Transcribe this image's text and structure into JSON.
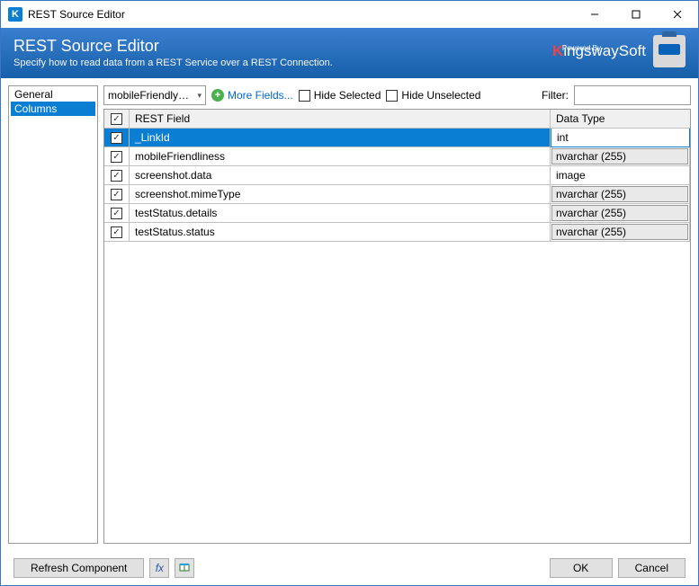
{
  "window": {
    "title": "REST Source Editor"
  },
  "banner": {
    "title": "REST Source Editor",
    "subtitle": "Specify how to read data from a REST Service over a REST Connection.",
    "poweredBy": "Powered By",
    "brand_prefix": "K",
    "brand_rest": "ingswaySoft"
  },
  "sidebar": {
    "items": [
      {
        "label": "General",
        "selected": false
      },
      {
        "label": "Columns",
        "selected": true
      }
    ]
  },
  "toolbar": {
    "dropdown_value": "mobileFriendlyTes",
    "more_fields": "More Fields...",
    "hide_selected": "Hide Selected",
    "hide_unselected": "Hide Unselected",
    "filter_label": "Filter:",
    "filter_value": ""
  },
  "grid": {
    "col_rest": "REST Field",
    "col_type": "Data Type",
    "rows": [
      {
        "checked": true,
        "field": "_LinkId",
        "type": "int",
        "selected": true
      },
      {
        "checked": true,
        "field": "mobileFriendliness",
        "type": "nvarchar (255)",
        "selected": false
      },
      {
        "checked": true,
        "field": "screenshot.data",
        "type": "image",
        "selected": false
      },
      {
        "checked": true,
        "field": "screenshot.mimeType",
        "type": "nvarchar (255)",
        "selected": false
      },
      {
        "checked": true,
        "field": "testStatus.details",
        "type": "nvarchar (255)",
        "selected": false
      },
      {
        "checked": true,
        "field": "testStatus.status",
        "type": "nvarchar (255)",
        "selected": false
      }
    ]
  },
  "footer": {
    "refresh": "Refresh Component",
    "ok": "OK",
    "cancel": "Cancel"
  }
}
